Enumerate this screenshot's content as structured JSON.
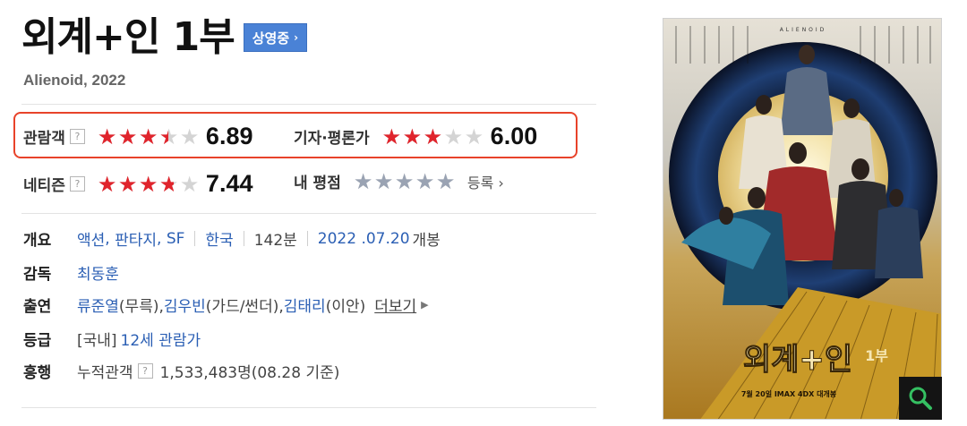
{
  "movie": {
    "title": "외계+인 1부",
    "status_badge": "상영중",
    "subtitle": "Alienoid, 2022"
  },
  "ratings": {
    "audience": {
      "label": "관람객",
      "help": "?",
      "score": "6.89",
      "fill": 0.689
    },
    "critics": {
      "label": "기자·평론가",
      "score": "6.00",
      "fill": 0.6
    },
    "netizen": {
      "label": "네티즌",
      "help": "?",
      "score": "7.44",
      "fill": 0.744
    },
    "my_rating": {
      "label": "내 평점",
      "fill": 0,
      "register_label": "등록"
    }
  },
  "info": {
    "overview": {
      "key": "개요",
      "genres": [
        "액션",
        "판타지",
        "SF"
      ],
      "country": "한국",
      "runtime": "142분",
      "release_date": "2022 .07.20",
      "release_suffix": "개봉"
    },
    "director": {
      "key": "감독",
      "name": "최동훈"
    },
    "cast": {
      "key": "출연",
      "actors": [
        {
          "name": "류준열",
          "role": "(무륵), "
        },
        {
          "name": "김우빈",
          "role": "(가드/썬더), "
        },
        {
          "name": "김태리",
          "role": "(이안)"
        }
      ],
      "more_label": "더보기"
    },
    "grade": {
      "key": "등급",
      "prefix": "[국내]",
      "value": "12세 관람가"
    },
    "box_office": {
      "key": "흥행",
      "label": "누적관객",
      "help": "?",
      "count": "1,533,483명",
      "date_note": "(08.28 기준)"
    }
  },
  "poster": {
    "english_title": "ALIENOID",
    "korean_title": "외계+인",
    "part": "1부",
    "release_line": "7월 20일 IMAX 4DX 대개봉"
  },
  "colors": {
    "star_red": "#e0242c",
    "star_empty": "#d4d4d4",
    "my_star": "#9aa3b3",
    "link_blue": "#2b5fb4",
    "badge_blue": "#4a82d6",
    "highlight": "#e8432a"
  }
}
